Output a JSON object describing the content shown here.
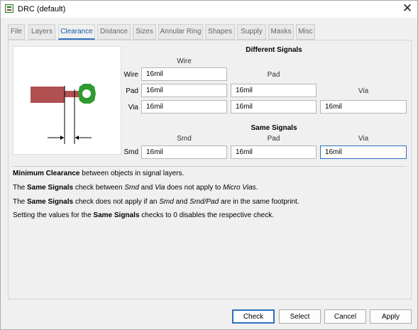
{
  "window": {
    "title": "DRC (default)"
  },
  "tabs": [
    {
      "label": "File"
    },
    {
      "label": "Layers"
    },
    {
      "label": "Clearance"
    },
    {
      "label": "Distance"
    },
    {
      "label": "Sizes"
    },
    {
      "label": "Annular Ring"
    },
    {
      "label": "Shapes"
    },
    {
      "label": "Supply"
    },
    {
      "label": "Masks"
    },
    {
      "label": "Misc"
    }
  ],
  "active_tab": "Clearance",
  "different_signals": {
    "title": "Different Signals",
    "col_wire": "Wire",
    "col_pad": "Pad",
    "col_via": "Via",
    "row_wire": "Wire",
    "row_pad": "Pad",
    "row_via": "Via",
    "wire_wire": "16mil",
    "pad_wire": "16mil",
    "pad_pad": "16mil",
    "via_wire": "16mil",
    "via_pad": "16mil",
    "via_via": "16mil"
  },
  "same_signals": {
    "title": "Same Signals",
    "col_smd": "Smd",
    "col_pad": "Pad",
    "col_via": "Via",
    "row_smd": "Smd",
    "smd_smd": "16mil",
    "smd_pad": "16mil",
    "smd_via": "16mil"
  },
  "info": {
    "line1_bold": "Minimum Clearance",
    "line1_rest": " between objects in signal layers.",
    "line2_a": "The ",
    "line2_b": "Same Signals",
    "line2_c": " check between ",
    "line2_d": "Smd",
    "line2_e": " and ",
    "line2_f": "Via",
    "line2_g": " does not apply to ",
    "line2_h": "Micro Vias",
    "line2_i": ".",
    "line3_a": "The ",
    "line3_b": "Same Signals",
    "line3_c": " check does not apply if an ",
    "line3_d": "Smd",
    "line3_e": " and ",
    "line3_f": "Smd/Pad",
    "line3_g": " are in the same footprint.",
    "line4_a": "Setting the values for the ",
    "line4_b": "Same Signals",
    "line4_c": " checks to 0 disables the respective check."
  },
  "buttons": {
    "check": "Check",
    "select": "Select",
    "cancel": "Cancel",
    "apply": "Apply"
  },
  "colors": {
    "wire": "#b05050",
    "via": "#2f9a2f",
    "accent": "#2e6fbf"
  }
}
